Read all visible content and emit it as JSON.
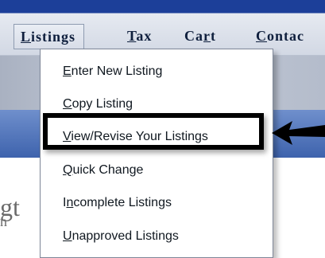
{
  "nav": {
    "items": [
      {
        "label": "Listings",
        "mnemonic_index": 0
      },
      {
        "label": "Tax",
        "mnemonic_index": 0
      },
      {
        "label": "Cart",
        "mnemonic_index": 2
      },
      {
        "label": "Contac",
        "mnemonic_index": 0
      }
    ]
  },
  "dropdown": {
    "items": [
      {
        "label": "Enter New Listing",
        "mnemonic_index": 0
      },
      {
        "label": "Copy Listing",
        "mnemonic_index": 0
      },
      {
        "label": "View/Revise Your Listings",
        "mnemonic_index": 0
      },
      {
        "label": "Quick Change",
        "mnemonic_index": 0
      },
      {
        "label": "Incomplete Listings",
        "mnemonic_index": 1
      },
      {
        "label": "Unapproved Listings",
        "mnemonic_index": 0
      }
    ],
    "highlighted_index": 2
  },
  "background": {
    "partial_text": [
      "gt",
      "n"
    ]
  },
  "colors": {
    "top_strip": "#1c3f99",
    "menu_bar": "#dde2eb",
    "page_band": "#4b6fb6",
    "highlight": "#000000"
  }
}
